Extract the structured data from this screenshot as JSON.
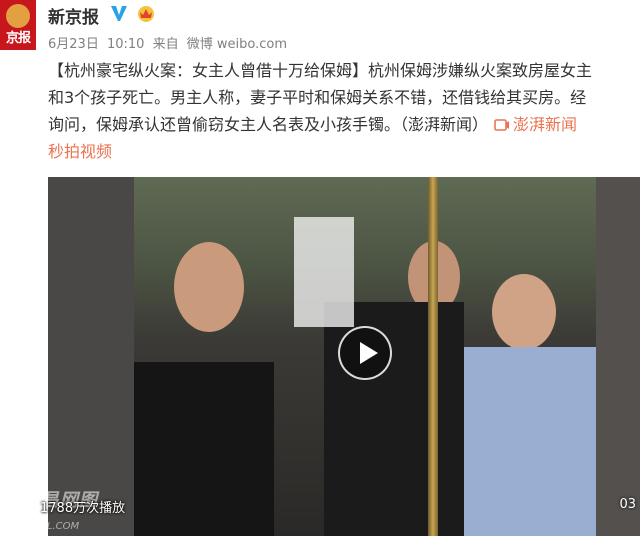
{
  "author": {
    "name": "新京报",
    "avatar_text": "京报"
  },
  "icons": {
    "verified": "verified-v-icon",
    "vip": "vip-crown-icon",
    "link": "video-link-icon",
    "play": "play-icon"
  },
  "colors": {
    "link": "#eb7350",
    "verified": "#2aa3e6",
    "avatar_bg": "#c8161d"
  },
  "meta": {
    "date": "6月23日",
    "time": "10:10",
    "via_label": "来自",
    "client": "微博 weibo.com"
  },
  "post": {
    "line1": "【杭州豪宅纵火案：女主人曾借十万给保姆】杭州保姆涉嫌纵火案致房屋女主",
    "line2": "和3个孩子死亡。男主人称，妻子平时和保姆关系不错，还借钱给其买房。经",
    "line3_text": "询问，保姆承认还曾偷窃女主人名表及小孩手镯。（澎湃新闻）",
    "line3_link": "澎湃新闻",
    "line4": "秒拍视频"
  },
  "video": {
    "view_count": "1788万次播放",
    "time": "03",
    "watermark": "平昌网图",
    "watermark_sub": "PCWL.COM"
  }
}
